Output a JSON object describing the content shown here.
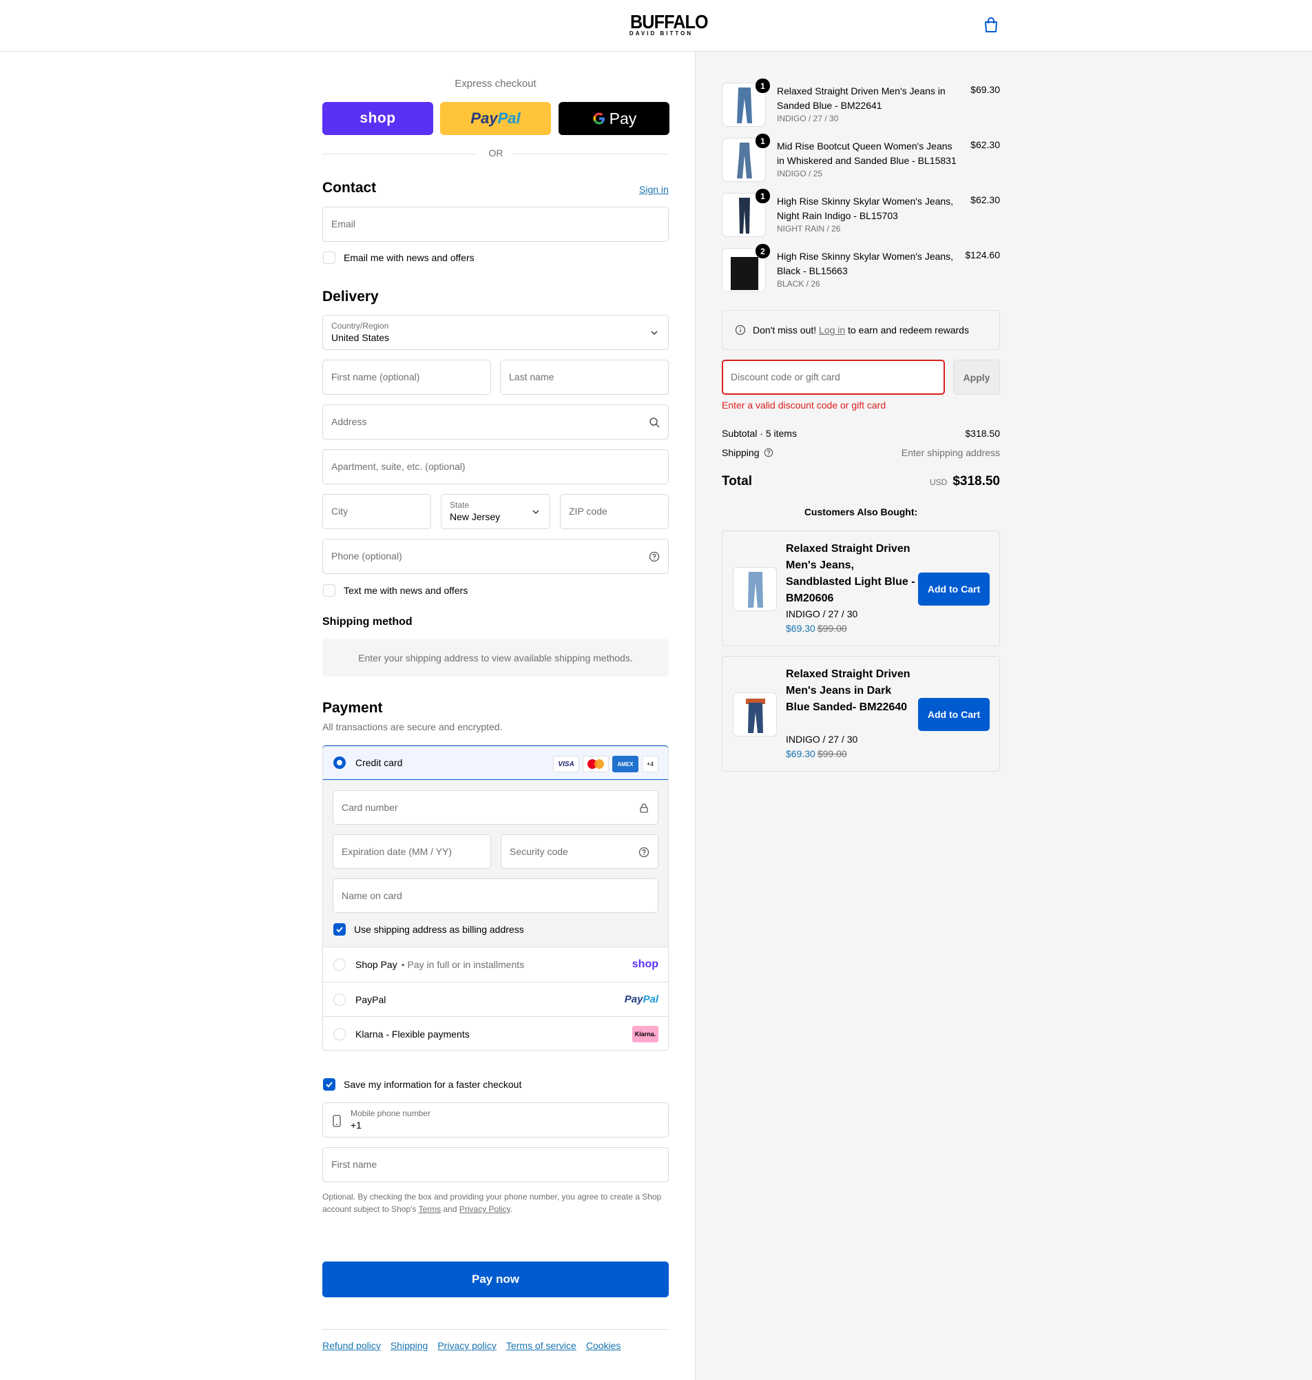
{
  "brand": {
    "logo_main": "BUFFALO",
    "logo_sub": "DAVID BITTON"
  },
  "header": {
    "cart_icon": "shopping-bag-icon"
  },
  "express": {
    "label": "Express checkout",
    "shop_label": "shop",
    "paypal_a": "Pay",
    "paypal_b": "Pal",
    "gpay_label": "Pay",
    "or": "OR"
  },
  "contact": {
    "title": "Contact",
    "sign_in": "Sign in",
    "email_placeholder": "Email",
    "news_checkbox": "Email me with news and offers"
  },
  "delivery": {
    "title": "Delivery",
    "country_label": "Country/Region",
    "country_value": "United States",
    "first_name_placeholder": "First name (optional)",
    "last_name_placeholder": "Last name",
    "address_placeholder": "Address",
    "apartment_placeholder": "Apartment, suite, etc. (optional)",
    "city_placeholder": "City",
    "state_label": "State",
    "state_value": "New Jersey",
    "zip_placeholder": "ZIP code",
    "phone_placeholder": "Phone (optional)",
    "text_checkbox": "Text me with news and offers"
  },
  "shipping_method": {
    "title": "Shipping method",
    "note": "Enter your shipping address to view available shipping methods."
  },
  "payment": {
    "title": "Payment",
    "subtitle": "All transactions are secure and encrypted.",
    "credit_card": "Credit card",
    "cards": {
      "visa": "VISA",
      "amex": "AMEX",
      "more": "+4"
    },
    "card_number": "Card number",
    "expiration": "Expiration date (MM / YY)",
    "security_code": "Security code",
    "name_on_card": "Name on card",
    "billing_checkbox": "Use shipping address as billing address",
    "shop_pay": "Shop Pay",
    "shop_pay_extra": "Pay in full or in installments",
    "shop_pay_logo": "shop",
    "paypal": "PayPal",
    "paypal_logo_a": "Pay",
    "paypal_logo_b": "Pal",
    "klarna": "Klarna - Flexible payments",
    "klarna_logo": "Klarna."
  },
  "save_info": {
    "checkbox": "Save my information for a faster checkout",
    "mobile_label": "Mobile phone number",
    "mobile_value": "+1",
    "first_name_placeholder": "First name",
    "fine_a": "Optional. By checking the box and providing your phone number, you agree to create a Shop account subject to Shop's ",
    "terms": "Terms",
    "and": " and ",
    "privacy": "Privacy Policy",
    "period": "."
  },
  "pay_now": "Pay now",
  "footer": {
    "links": [
      "Refund policy",
      "Shipping",
      "Privacy policy",
      "Terms of service",
      "Cookies"
    ]
  },
  "order": {
    "items": [
      {
        "name": "Relaxed Straight Driven Men's Jeans in Sanded Blue - BM22641",
        "variant": "INDIGO / 27 / 30",
        "price": "$69.30",
        "qty": "1",
        "color": "#4d78a6"
      },
      {
        "name": "Mid Rise Bootcut Queen Women's Jeans in Whiskered and Sanded Blue - BL15831",
        "variant": "INDIGO / 25",
        "price": "$62.30",
        "qty": "1",
        "color": "#54779f"
      },
      {
        "name": "High Rise Skinny Skylar Women's Jeans, Night Rain Indigo - BL15703",
        "variant": "NIGHT RAIN / 26",
        "price": "$62.30",
        "qty": "1",
        "color": "#22324a"
      },
      {
        "name": "High Rise Skinny Skylar Women's Jeans, Black - BL15663",
        "variant": "BLACK / 26",
        "price": "$124.60",
        "qty": "2",
        "color": "#151515"
      }
    ],
    "rewards_a": "Don't miss out! ",
    "rewards_link": "Log in",
    "rewards_b": " to earn and redeem rewards",
    "discount_placeholder": "Discount code or gift card",
    "apply": "Apply",
    "discount_error": "Enter a valid discount code or gift card",
    "subtotal_label": "Subtotal · 5 items",
    "subtotal_value": "$318.50",
    "shipping_label": "Shipping",
    "shipping_value": "Enter shipping address",
    "total_label": "Total",
    "currency": "USD",
    "total_value": "$318.50"
  },
  "upsell": {
    "title": "Customers Also Bought:",
    "items": [
      {
        "name": "Relaxed Straight Driven Men's Jeans, Sandblasted Light Blue - BM20606",
        "variant": "INDIGO / 27 / 30",
        "price": "$69.30",
        "was": "$99.00",
        "button": "Add to Cart",
        "color": "#7ea3c9"
      },
      {
        "name": "Relaxed Straight Driven Men's Jeans in Dark Blue Sanded- BM22640",
        "variant": "INDIGO / 27 / 30",
        "price": "$69.30",
        "was": "$99.00",
        "button": "Add to Cart",
        "color": "#2f4d78"
      }
    ]
  },
  "colors": {
    "accent": "#005bd1",
    "error": "#dd1d1d",
    "shop_purple": "#5a31f4",
    "paypal_yellow": "#ffc439"
  }
}
